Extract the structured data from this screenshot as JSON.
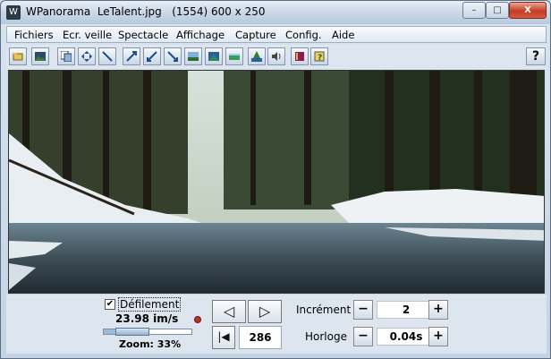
{
  "window": {
    "title": "WPanorama  LeTalent.jpg   (1554) 600 x 250",
    "app_icon": "panorama-app-icon",
    "controls": {
      "minimize": "–",
      "maximize": "□",
      "close": "X"
    }
  },
  "menu": [
    "Fichiers",
    "Ecr. veille",
    "Spectacle",
    "Affichage",
    "Capture",
    "Config.",
    "Aide"
  ],
  "toolbar": {
    "icons": [
      "open-folder-icon",
      "image-icon",
      "copy-image-icon",
      "move-arrows-icon",
      "shrink-arrows-icon",
      "expand-arrows-icon",
      "zoom-in-arrows-icon",
      "zoom-out-arrows-icon",
      "landscape-thumb-icon",
      "landscape-blue-icon",
      "landscape-green-icon",
      "sound-icon",
      "book-icon",
      "help-book-icon"
    ],
    "help_label": "?"
  },
  "image": {
    "description_icon": "panorama-photo"
  },
  "controls": {
    "scroll_checkbox_label": "Défilement",
    "scroll_checked": true,
    "checkbox_mark": "✔",
    "speed": "23.98 im/s",
    "zoom": "Zoom: 33%",
    "zoom_level": 0.33,
    "prev_label": "◁",
    "next_label": "▷",
    "first_label": "|◀",
    "frame_counter": "286",
    "increment_label": "Incrément",
    "increment_value": "2",
    "clock_label": "Horloge",
    "clock_value": "0.04s",
    "minus": "−",
    "plus": "+"
  },
  "colors": {
    "accent": "#3a6ea5",
    "close_button": "#c43c24"
  }
}
